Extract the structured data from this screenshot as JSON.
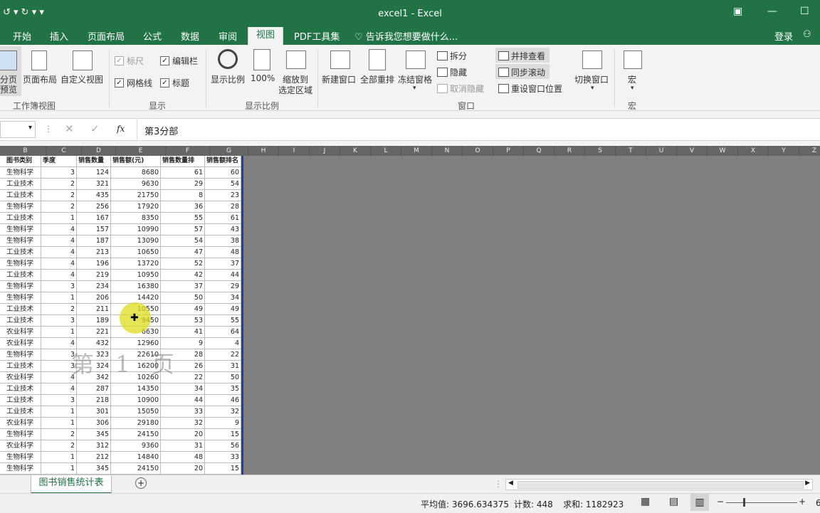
{
  "window": {
    "title": "excel1 - Excel"
  },
  "tabs": [
    "开始",
    "插入",
    "页面布局",
    "公式",
    "数据",
    "审阅",
    "视图",
    "PDF工具集"
  ],
  "active_tab": "视图",
  "tell_me": "告诉我您想要做什么...",
  "login": "登录",
  "ribbon": {
    "workbook_views": {
      "group": "工作簿视图",
      "pagebreak": "分页\n预览",
      "page_layout": "页面布局",
      "custom_view": "自定义视图"
    },
    "show": {
      "group": "显示",
      "ruler": "标尺",
      "formula_bar": "编辑栏",
      "gridlines": "网格线",
      "headings": "标题"
    },
    "zoom": {
      "group": "显示比例",
      "zoom": "显示比例",
      "100": "100%",
      "zoom_sel_1": "缩放到",
      "zoom_sel_2": "选定区域"
    },
    "window": {
      "group": "窗口",
      "new_window": "新建窗口",
      "arrange_all": "全部重排",
      "freeze": "冻结窗格",
      "split": "拆分",
      "hide": "隐藏",
      "unhide": "取消隐藏",
      "side_by_side": "并排查看",
      "sync_scroll": "同步滚动",
      "reset_pos": "重设窗口位置",
      "switch": "切换窗口"
    },
    "macros": {
      "group": "宏",
      "macro": "宏"
    }
  },
  "formula_bar": {
    "name_box": "",
    "fx": "fx",
    "content": "第3分部"
  },
  "columns": [
    "B",
    "C",
    "D",
    "E",
    "F",
    "G",
    "H",
    "I",
    "J",
    "K",
    "L",
    "M",
    "N",
    "O",
    "P",
    "Q",
    "R",
    "S",
    "T",
    "U",
    "V",
    "W",
    "X",
    "Y",
    "Z"
  ],
  "table": {
    "headers": [
      "图书类别",
      "季度",
      "销售数量",
      "销售额(元)",
      "销售数量排",
      "销售额排名"
    ],
    "rows": [
      [
        "生物科学",
        "3",
        "124",
        "8680",
        "61",
        "60"
      ],
      [
        "工业技术",
        "2",
        "321",
        "9630",
        "29",
        "54"
      ],
      [
        "工业技术",
        "2",
        "435",
        "21750",
        "8",
        "23"
      ],
      [
        "生物科学",
        "2",
        "256",
        "17920",
        "36",
        "28"
      ],
      [
        "工业技术",
        "1",
        "167",
        "8350",
        "55",
        "61"
      ],
      [
        "生物科学",
        "4",
        "157",
        "10990",
        "57",
        "43"
      ],
      [
        "生物科学",
        "4",
        "187",
        "13090",
        "54",
        "38"
      ],
      [
        "工业技术",
        "4",
        "213",
        "10650",
        "47",
        "48"
      ],
      [
        "生物科学",
        "4",
        "196",
        "13720",
        "52",
        "37"
      ],
      [
        "工业技术",
        "4",
        "219",
        "10950",
        "42",
        "44"
      ],
      [
        "生物科学",
        "3",
        "234",
        "16380",
        "37",
        "29"
      ],
      [
        "生物科学",
        "1",
        "206",
        "14420",
        "50",
        "34"
      ],
      [
        "工业技术",
        "2",
        "211",
        "10550",
        "49",
        "49"
      ],
      [
        "工业技术",
        "3",
        "189",
        "9450",
        "53",
        "55"
      ],
      [
        "农业科学",
        "1",
        "221",
        "6630",
        "41",
        "64"
      ],
      [
        "农业科学",
        "4",
        "432",
        "12960",
        "9",
        "4"
      ],
      [
        "生物科学",
        "3",
        "323",
        "22610",
        "28",
        "22"
      ],
      [
        "工业技术",
        "3",
        "324",
        "16200",
        "26",
        "31"
      ],
      [
        "农业科学",
        "4",
        "342",
        "10260",
        "22",
        "50"
      ],
      [
        "工业技术",
        "4",
        "287",
        "14350",
        "34",
        "35"
      ],
      [
        "工业技术",
        "3",
        "218",
        "10900",
        "44",
        "46"
      ],
      [
        "工业技术",
        "1",
        "301",
        "15050",
        "33",
        "32"
      ],
      [
        "农业科学",
        "1",
        "306",
        "29180",
        "32",
        "9"
      ],
      [
        "生物科学",
        "2",
        "345",
        "24150",
        "20",
        "15"
      ],
      [
        "农业科学",
        "2",
        "312",
        "9360",
        "31",
        "56"
      ],
      [
        "生物科学",
        "1",
        "212",
        "14840",
        "48",
        "33"
      ],
      [
        "生物科学",
        "1",
        "345",
        "24150",
        "20",
        "15"
      ]
    ]
  },
  "watermark": "第 1 页",
  "sheet_tab": "图书销售统计表",
  "status": {
    "average": "平均值: 3696.634375",
    "count": "计数: 448",
    "sum": "求和: 1182923",
    "zoom": "6"
  },
  "colors": {
    "excel_green": "#217346",
    "page_border": "#1f3fa8",
    "gray_area": "#808080"
  }
}
